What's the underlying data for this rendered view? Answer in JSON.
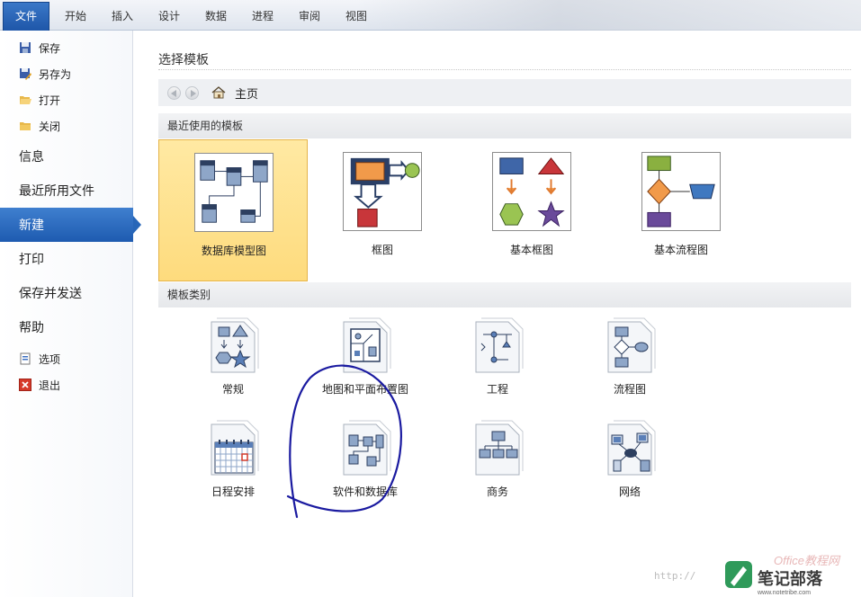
{
  "ribbon": {
    "tabs": [
      "文件",
      "开始",
      "插入",
      "设计",
      "数据",
      "进程",
      "审阅",
      "视图"
    ]
  },
  "nav": {
    "save": "保存",
    "save_as": "另存为",
    "open": "打开",
    "close": "关闭",
    "info": "信息",
    "recent": "最近所用文件",
    "new": "新建",
    "print": "打印",
    "save_send": "保存并发送",
    "help": "帮助",
    "options": "选项",
    "exit": "退出"
  },
  "main": {
    "title": "选择模板",
    "home": "主页",
    "recent_header": "最近使用的模板",
    "recent_templates": [
      "数据库模型图",
      "框图",
      "基本框图",
      "基本流程图"
    ],
    "category_header": "模板类别",
    "categories": [
      "常规",
      "地图和平面布置图",
      "工程",
      "流程图",
      "日程安排",
      "软件和数据库",
      "商务",
      "网络"
    ]
  },
  "watermark": {
    "url": "http://",
    "logo_text": "笔记部落",
    "logo_brand": "Office教程网",
    "logo_url": "www.notetribe.com"
  },
  "colors": {
    "accent": "#1e5bb0",
    "selected_bg": "#fedb7d",
    "annotation": "#1a1aa0"
  }
}
